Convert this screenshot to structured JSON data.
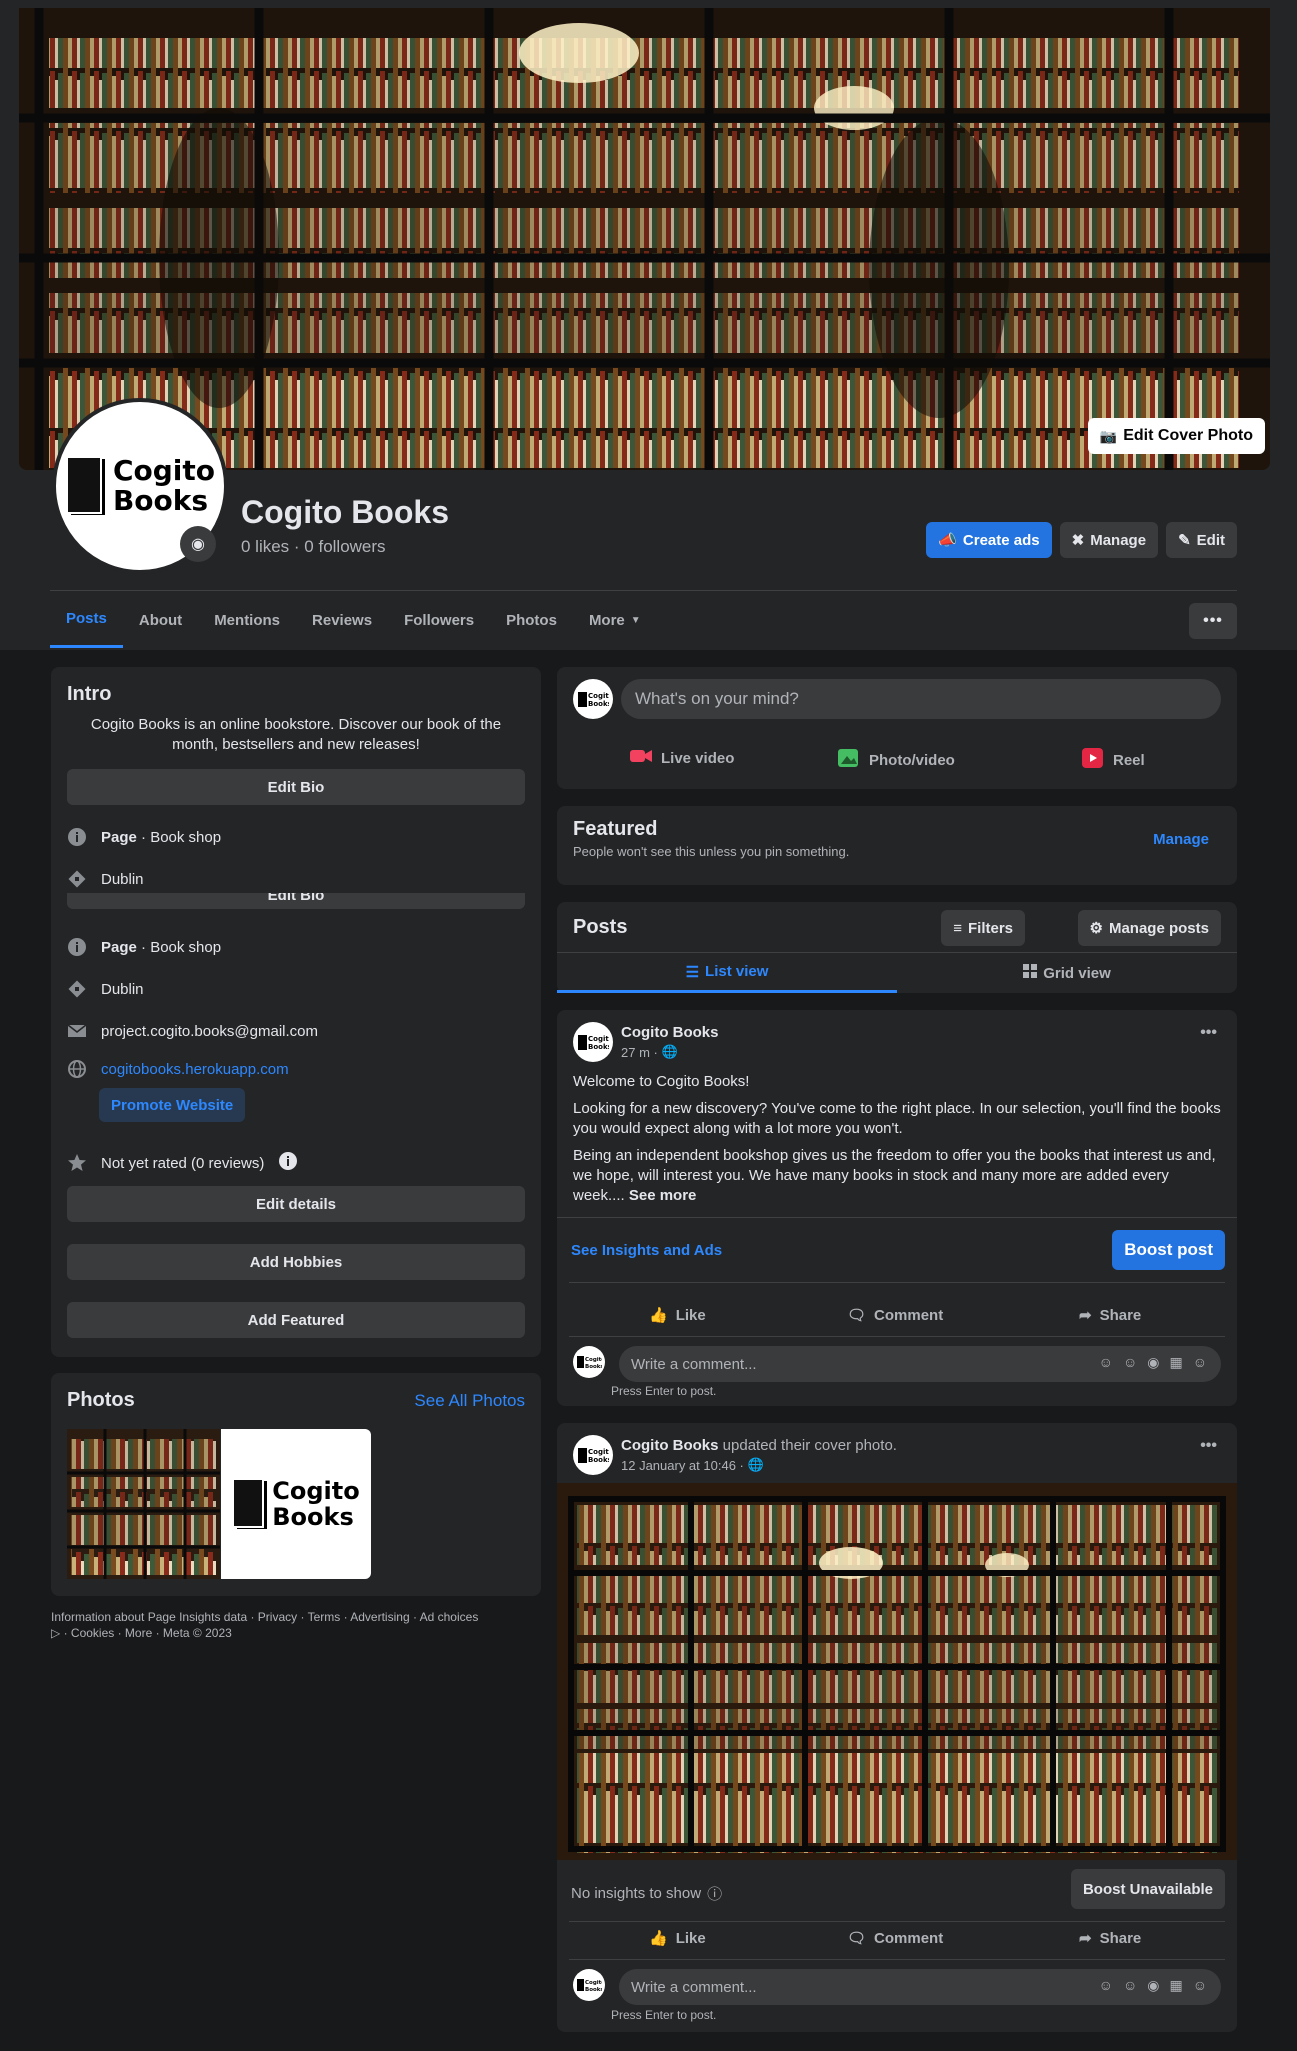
{
  "cover": {
    "edit_label": "Edit Cover Photo"
  },
  "profile": {
    "logo_line1": "Cogito",
    "logo_line2": "Books",
    "name": "Cogito Books",
    "stats": "0 likes · 0 followers"
  },
  "header_buttons": {
    "create_ads": "Create ads",
    "manage": "Manage",
    "edit": "Edit"
  },
  "tabs": [
    "Posts",
    "About",
    "Mentions",
    "Reviews",
    "Followers",
    "Photos",
    "More"
  ],
  "intro": {
    "title": "Intro",
    "bio": "Cogito Books is an online bookstore. Discover our book of the month, bestsellers and new releases!",
    "edit_bio": "Edit Bio",
    "page_label": "Page",
    "page_category": " · Book shop",
    "location": "Dublin",
    "email": "project.cogito.books@gmail.com",
    "website": "cogitobooks.herokuapp.com",
    "promote": "Promote Website",
    "rating": "Not yet rated (0 reviews)",
    "edit_details": "Edit details",
    "add_hobbies": "Add Hobbies",
    "add_featured": "Add Featured"
  },
  "photos": {
    "title": "Photos",
    "see_all": "See All Photos"
  },
  "footer": {
    "line1": "Information about Page Insights data · Privacy · Terms · Advertising · Ad choices",
    "line2": " · Cookies · More · Meta © 2023"
  },
  "composer": {
    "placeholder": "What's on your mind?",
    "live": "Live video",
    "photo": "Photo/video",
    "reel": "Reel"
  },
  "featured": {
    "title": "Featured",
    "subtitle": "People won't see this unless you pin something.",
    "manage": "Manage"
  },
  "posts_header": {
    "title": "Posts",
    "filters": "Filters",
    "manage_posts": "Manage posts",
    "list_view": "List view",
    "grid_view": "Grid view"
  },
  "post1": {
    "author": "Cogito Books",
    "time": "27 m ·",
    "p1": "Welcome to Cogito Books!",
    "p2": "Looking for a new discovery? You've come to the right place. In our selection, you'll find the books you would expect along with a lot more you won't.",
    "p3": "Being an independent bookshop gives us the freedom to offer you the books that interest us and, we hope, will interest you. We have many books in stock and many more are added every week....",
    "see_more": "See more",
    "insights": "See Insights and Ads",
    "boost": "Boost post"
  },
  "post2": {
    "author": "Cogito Books",
    "action": " updated their cover photo.",
    "time": "12 January at 10:46 ·",
    "no_insights": "No insights to show",
    "boost": "Boost Unavailable"
  },
  "actions": {
    "like": "Like",
    "comment": "Comment",
    "share": "Share"
  },
  "comment": {
    "placeholder": "Write a comment...",
    "hint": "Press Enter to post."
  },
  "colors": {
    "bg": "#18191a",
    "card": "#242526",
    "accent": "#2d88ff",
    "button_blue": "#2374e1"
  }
}
